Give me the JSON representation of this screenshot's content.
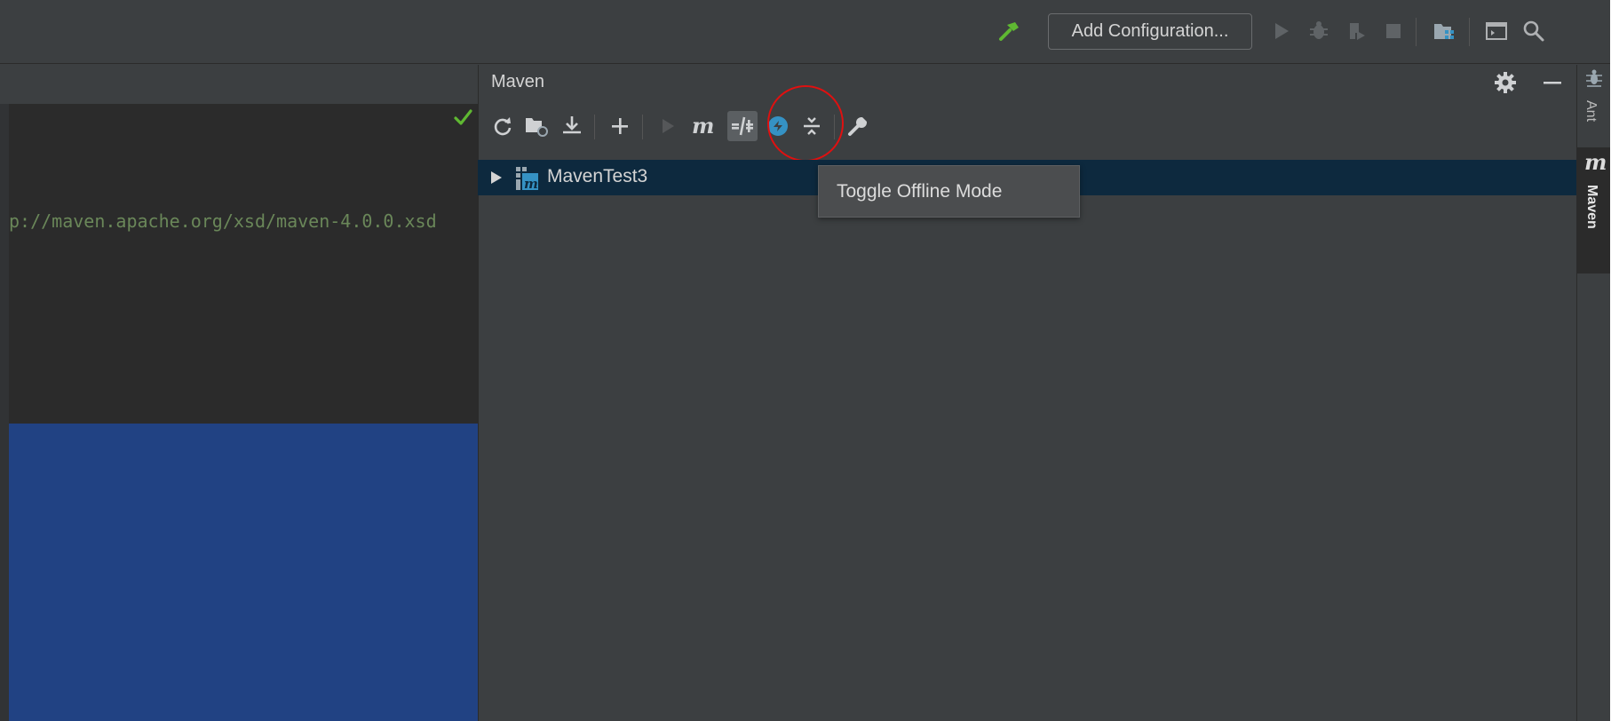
{
  "toolbar": {
    "add_configuration_label": "Add Configuration..."
  },
  "editor": {
    "code_line": "p://maven.apache.org/xsd/maven-4.0.0.xsd"
  },
  "maven_panel": {
    "title": "Maven",
    "project_name": "MavenTest3",
    "tooltip": "Toggle Offline Mode"
  },
  "right_strip": {
    "ant_label": "Ant",
    "maven_letter": "m",
    "maven_label": "Maven"
  },
  "colors": {
    "background": "#3c3f41",
    "editor_bg": "#2b2b2b",
    "selection_blue": "#214283",
    "tree_selection": "#0d293e",
    "highlight_circle": "#e01010",
    "string_green": "#6a8759",
    "build_hammer": "#4caf50",
    "run_disabled": "#5f6366"
  }
}
